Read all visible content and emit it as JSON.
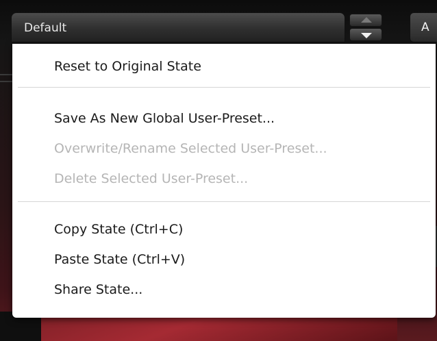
{
  "preset_selector": {
    "value": "Default"
  },
  "ab_button": {
    "label": "A"
  },
  "stepper": {
    "up_icon": "triangle-up",
    "down_icon": "triangle-down"
  },
  "menu": {
    "items": [
      {
        "label": "Reset to Original State",
        "enabled": true
      },
      {
        "label": "Save As New Global User-Preset...",
        "enabled": true
      },
      {
        "label": "Overwrite/Rename Selected User-Preset...",
        "enabled": false
      },
      {
        "label": "Delete Selected User-Preset...",
        "enabled": false
      },
      {
        "label": "Copy State (Ctrl+C)",
        "enabled": true
      },
      {
        "label": "Paste State (Ctrl+V)",
        "enabled": true
      },
      {
        "label": "Share State...",
        "enabled": true
      }
    ]
  },
  "colors": {
    "menu_background": "#ffffff",
    "menu_text": "#1a1a1a",
    "menu_text_disabled": "#b5b5b5",
    "plugin_accent_red": "#a52a33"
  }
}
